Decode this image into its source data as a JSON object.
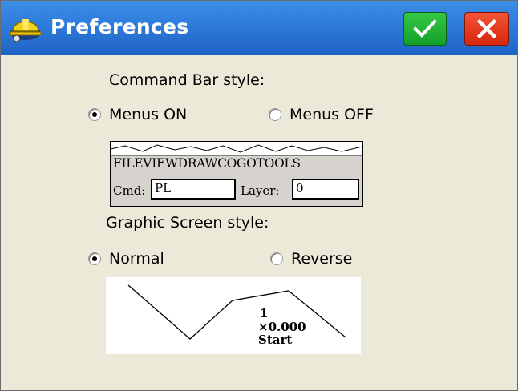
{
  "window": {
    "title": "Preferences",
    "ok_icon": "checkmark-icon",
    "close_icon": "close-icon"
  },
  "command_bar": {
    "heading": "Command Bar style:",
    "option_on": "Menus ON",
    "option_off": "Menus OFF",
    "selected": "Menus ON",
    "preview": {
      "menus": [
        "FILE",
        "VIEW",
        "DRAW",
        "COGO",
        "TOOLS"
      ],
      "cmd_label": "Cmd:",
      "cmd_value": "PL",
      "layer_label": "Layer:",
      "layer_value": "0"
    }
  },
  "graphic_screen": {
    "heading": "Graphic Screen style:",
    "option_normal": "Normal",
    "option_reverse": "Reverse",
    "selected": "Normal",
    "preview": {
      "line1": "1",
      "line2": "×0.000",
      "line3": "Start"
    }
  },
  "colors": {
    "titlebar": "#2f7ddc",
    "ok_button": "#1fae30",
    "close_button": "#e23a1c",
    "background": "#ece9d8"
  }
}
